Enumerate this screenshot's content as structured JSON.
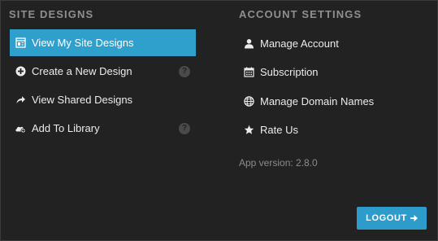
{
  "site_designs": {
    "title": "SITE DESIGNS",
    "items": [
      {
        "label": "View My Site Designs",
        "icon": "designs-icon",
        "active": true
      },
      {
        "label": "Create a New Design",
        "icon": "plus-circle-icon",
        "help": "?"
      },
      {
        "label": "View Shared Designs",
        "icon": "share-arrow-icon"
      },
      {
        "label": "Add To Library",
        "icon": "cloud-plus-icon",
        "help": "?"
      }
    ]
  },
  "account_settings": {
    "title": "ACCOUNT SETTINGS",
    "items": [
      {
        "label": "Manage Account",
        "icon": "user-icon"
      },
      {
        "label": "Subscription",
        "icon": "calendar-icon"
      },
      {
        "label": "Manage Domain Names",
        "icon": "globe-icon"
      },
      {
        "label": "Rate Us",
        "icon": "star-icon"
      }
    ]
  },
  "app_version": "App version: 2.8.0",
  "logout_label": "LOGOUT",
  "colors": {
    "background": "#222222",
    "accent": "#2fa0cc",
    "section_title": "#8f8f8f",
    "text": "#ececec"
  }
}
